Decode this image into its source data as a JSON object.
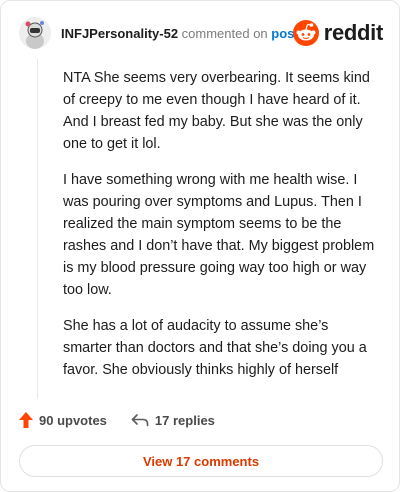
{
  "header": {
    "username": "INFJPersonality-52",
    "commented_text": "commented on",
    "post_link": "post",
    "brand_name": "reddit",
    "brand_color": "#ff4500"
  },
  "comment": {
    "paragraphs": [
      "NTA She seems very overbearing. It seems kind of creepy to me even though I have heard of it. And I breast fed my baby. But she was the only one to get it lol.",
      "I have something wrong with me health wise. I was pouring over symptoms and Lupus. Then I realized the main symptom seems to be the rashes and I don’t have that. My biggest problem is my blood pressure going way too high or way too low.",
      "She has a lot of audacity to assume she’s smarter than doctors and that she’s doing you a favor. She obviously thinks highly of herself"
    ]
  },
  "footer": {
    "upvotes": "90 upvotes",
    "replies": "17 replies",
    "view_button": "View 17 comments",
    "icons": [
      "upvote-arrow-icon",
      "reply-arrow-icon"
    ],
    "accent_color": "#d93a00"
  }
}
